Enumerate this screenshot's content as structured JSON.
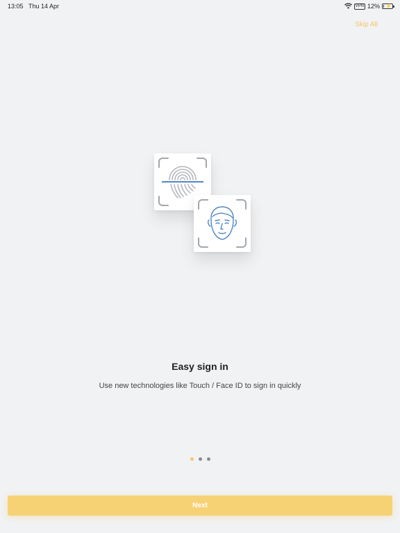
{
  "status_bar": {
    "time": "13:05",
    "date": "Thu 14 Apr",
    "vpn": "VPN",
    "battery": "12%",
    "battery_level": 0.12,
    "icons": [
      "wifi-icon",
      "vpn-badge",
      "battery-charging-icon"
    ]
  },
  "header": {
    "skip_label": "Skip All"
  },
  "illustration": {
    "icons": [
      "fingerprint-icon",
      "face-id-icon"
    ]
  },
  "onboarding": {
    "title": "Easy sign in",
    "subtitle": "Use new technologies like Touch / Face ID to sign in quickly"
  },
  "pager": {
    "total": 3,
    "current": 1
  },
  "footer": {
    "next_label": "Next"
  },
  "colors": {
    "accent": "#f3c76a",
    "button": "#f6d275",
    "background": "#f1f2f4",
    "icon_blue": "#4f86c6"
  }
}
